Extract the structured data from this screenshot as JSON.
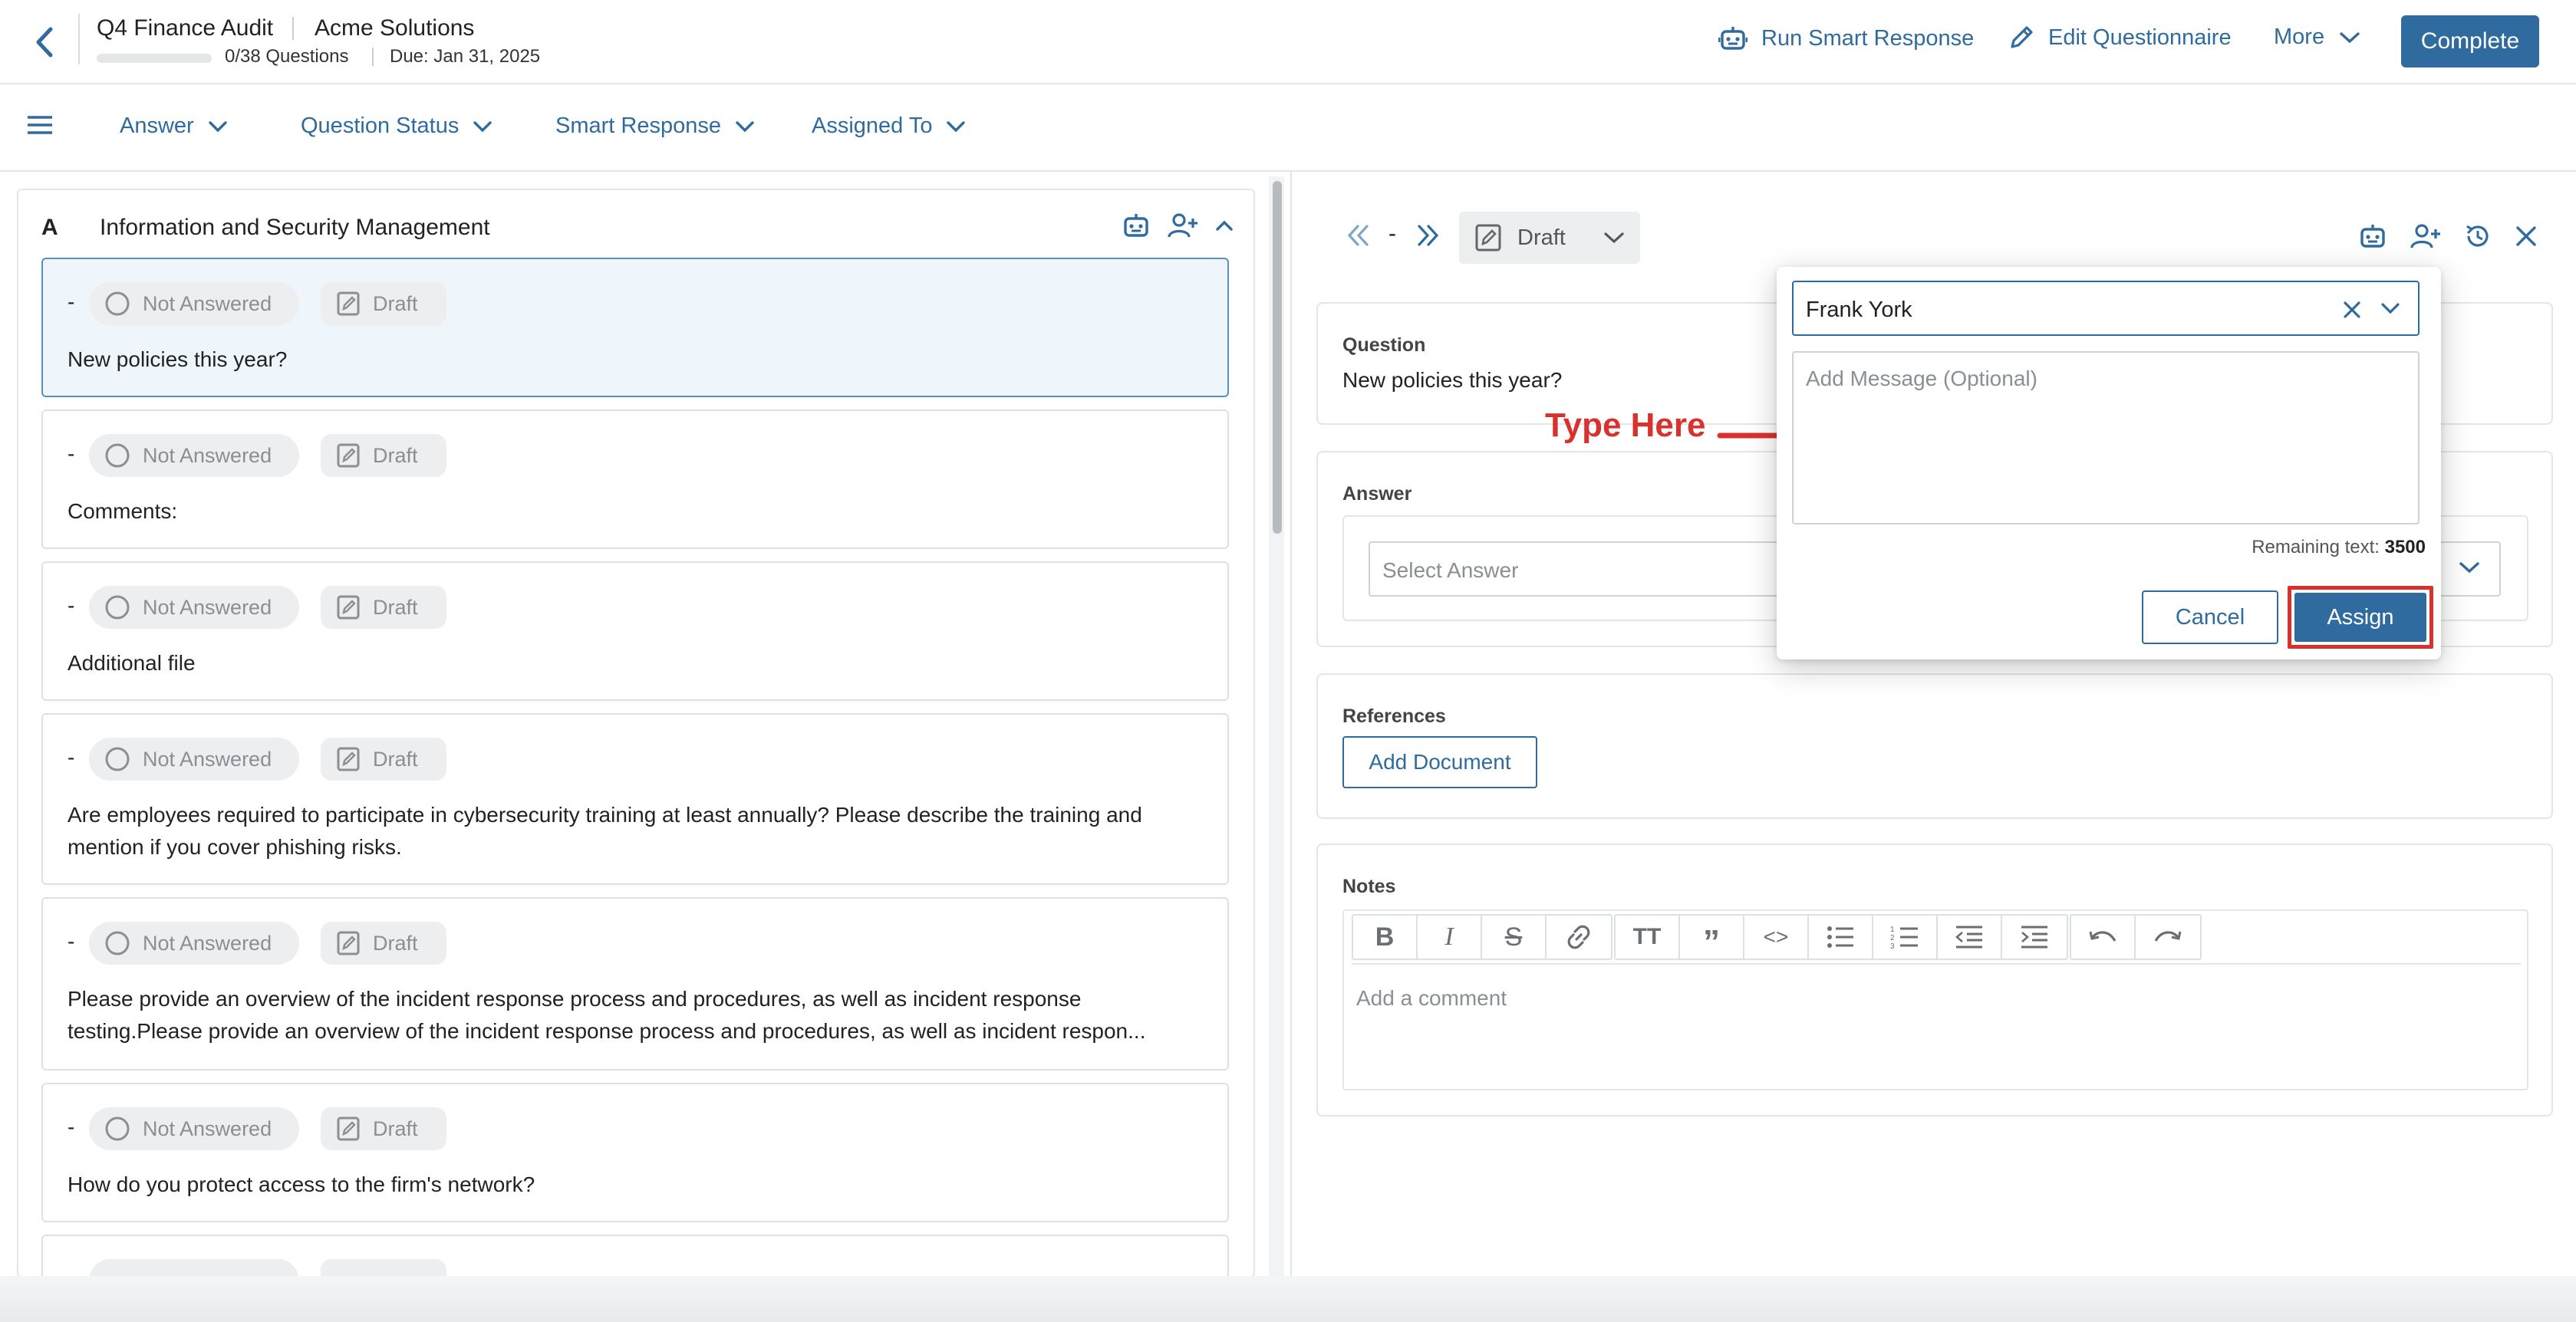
{
  "header": {
    "questionnaire_title": "Q4 Finance Audit",
    "organization": "Acme Solutions",
    "progress": {
      "answered": 0,
      "total": 38,
      "label": "0/38 Questions",
      "fraction": 0
    },
    "due": "Due: Jan 31, 2025",
    "actions": {
      "run_smart_response": "Run Smart Response",
      "edit_questionnaire": "Edit Questionnaire",
      "more": "More",
      "complete": "Complete"
    }
  },
  "filters": [
    "Answer",
    "Question Status",
    "Smart Response",
    "Assigned To"
  ],
  "section": {
    "letter": "A",
    "title": "Information and Security Management"
  },
  "questions": [
    {
      "num": "-",
      "status": "Not Answered",
      "state": "Draft",
      "text": "New policies this year?"
    },
    {
      "num": "-",
      "status": "Not Answered",
      "state": "Draft",
      "text": "Comments:"
    },
    {
      "num": "-",
      "status": "Not Answered",
      "state": "Draft",
      "text": "Additional file"
    },
    {
      "num": "-",
      "status": "Not Answered",
      "state": "Draft",
      "text": "Are employees required to participate in cybersecurity training at least annually? Please describe the training and mention if you cover phishing risks."
    },
    {
      "num": "-",
      "status": "Not Answered",
      "state": "Draft",
      "text_line1": "Please provide an overview of the incident response process and procedures, as well as incident response",
      "text_line2": "testing.Please provide an overview of the incident response process and procedures, as well as incident respon..."
    },
    {
      "num": "-",
      "status": "Not Answered",
      "state": "Draft",
      "text": "How do you protect access to the firm's network?"
    }
  ],
  "detail": {
    "nav_number": "-",
    "state": "Draft",
    "question_label": "Question",
    "question_text": "New policies this year?",
    "answer_label": "Answer",
    "answer_placeholder": "Select Answer",
    "references_label": "References",
    "add_document": "Add Document",
    "notes_label": "Notes",
    "notes_placeholder": "Add a comment"
  },
  "assign_popover": {
    "assignee": "Frank York",
    "message_placeholder": "Add Message (Optional)",
    "remaining_label": "Remaining text:",
    "remaining_count": "3500",
    "cancel": "Cancel",
    "assign": "Assign"
  },
  "annotation": {
    "text": "Type Here",
    "color": "#d9322e"
  },
  "colors": {
    "accent": "#2f6b9e",
    "highlight": "#d9322e",
    "selected_bg": "#eef5fb"
  },
  "icons": [
    "back-icon",
    "robot-icon",
    "pencil-icon",
    "chevron-down-icon",
    "menu-icon",
    "assign-user-icon",
    "chevron-up-icon",
    "circle-icon",
    "draft-icon",
    "double-chevron-left-icon",
    "double-chevron-right-icon",
    "history-icon",
    "close-icon"
  ]
}
